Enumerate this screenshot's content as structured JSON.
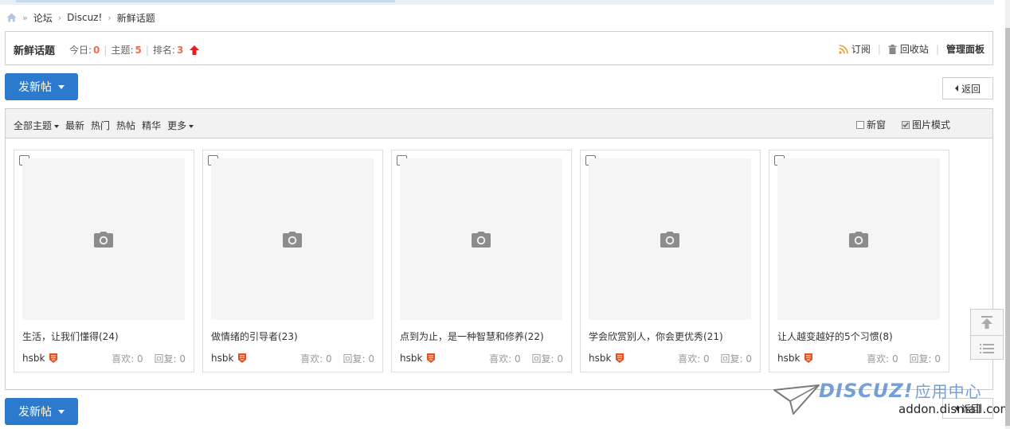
{
  "breadcrumb": {
    "home_icon": "home-icon",
    "items": [
      "论坛",
      "Discuz!",
      "新鲜话题"
    ]
  },
  "forum": {
    "title": "新鲜话题",
    "today_label": "今日:",
    "today": "0",
    "threads_label": "主题:",
    "threads": "5",
    "rank_label": "排名:",
    "rank": "3",
    "rank_icon": "rank-up-icon"
  },
  "links": {
    "subscribe": "订阅",
    "recycle": "回收站",
    "admin": "管理面板"
  },
  "actions": {
    "new_post": "发新帖",
    "back": "返回"
  },
  "filters": {
    "all": "全部主题",
    "newest": "最新",
    "hot": "热门",
    "hot_posts": "热帖",
    "digest": "精华",
    "more": "更多",
    "new_window": "新窗",
    "image_mode": "图片模式"
  },
  "cards": [
    {
      "subject": "生活，让我们懂得(24)",
      "author": "hsbk",
      "likes_label": "喜欢:",
      "likes": "0",
      "replies_label": "回复:",
      "replies": "0"
    },
    {
      "subject": "做情绪的引导者(23)",
      "author": "hsbk",
      "likes_label": "喜欢:",
      "likes": "0",
      "replies_label": "回复:",
      "replies": "0"
    },
    {
      "subject": "点到为止，是一种智慧和修养(22)",
      "author": "hsbk",
      "likes_label": "喜欢:",
      "likes": "0",
      "replies_label": "回复:",
      "replies": "0"
    },
    {
      "subject": "学会欣赏别人，你会更优秀(21)",
      "author": "hsbk",
      "likes_label": "喜欢:",
      "likes": "0",
      "replies_label": "回复:",
      "replies": "0"
    },
    {
      "subject": "让人越变越好的5个习惯(8)",
      "author": "hsbk",
      "likes_label": "喜欢:",
      "likes": "0",
      "replies_label": "回复:",
      "replies": "0"
    }
  ],
  "watermark": {
    "brand": "DISCUZ!",
    "brand_cn": "应用中心",
    "url": "addon.dismall.com"
  },
  "colors": {
    "accent": "#2b7acd",
    "highlight": "#f26c4f",
    "rank_up": "#e02020"
  }
}
